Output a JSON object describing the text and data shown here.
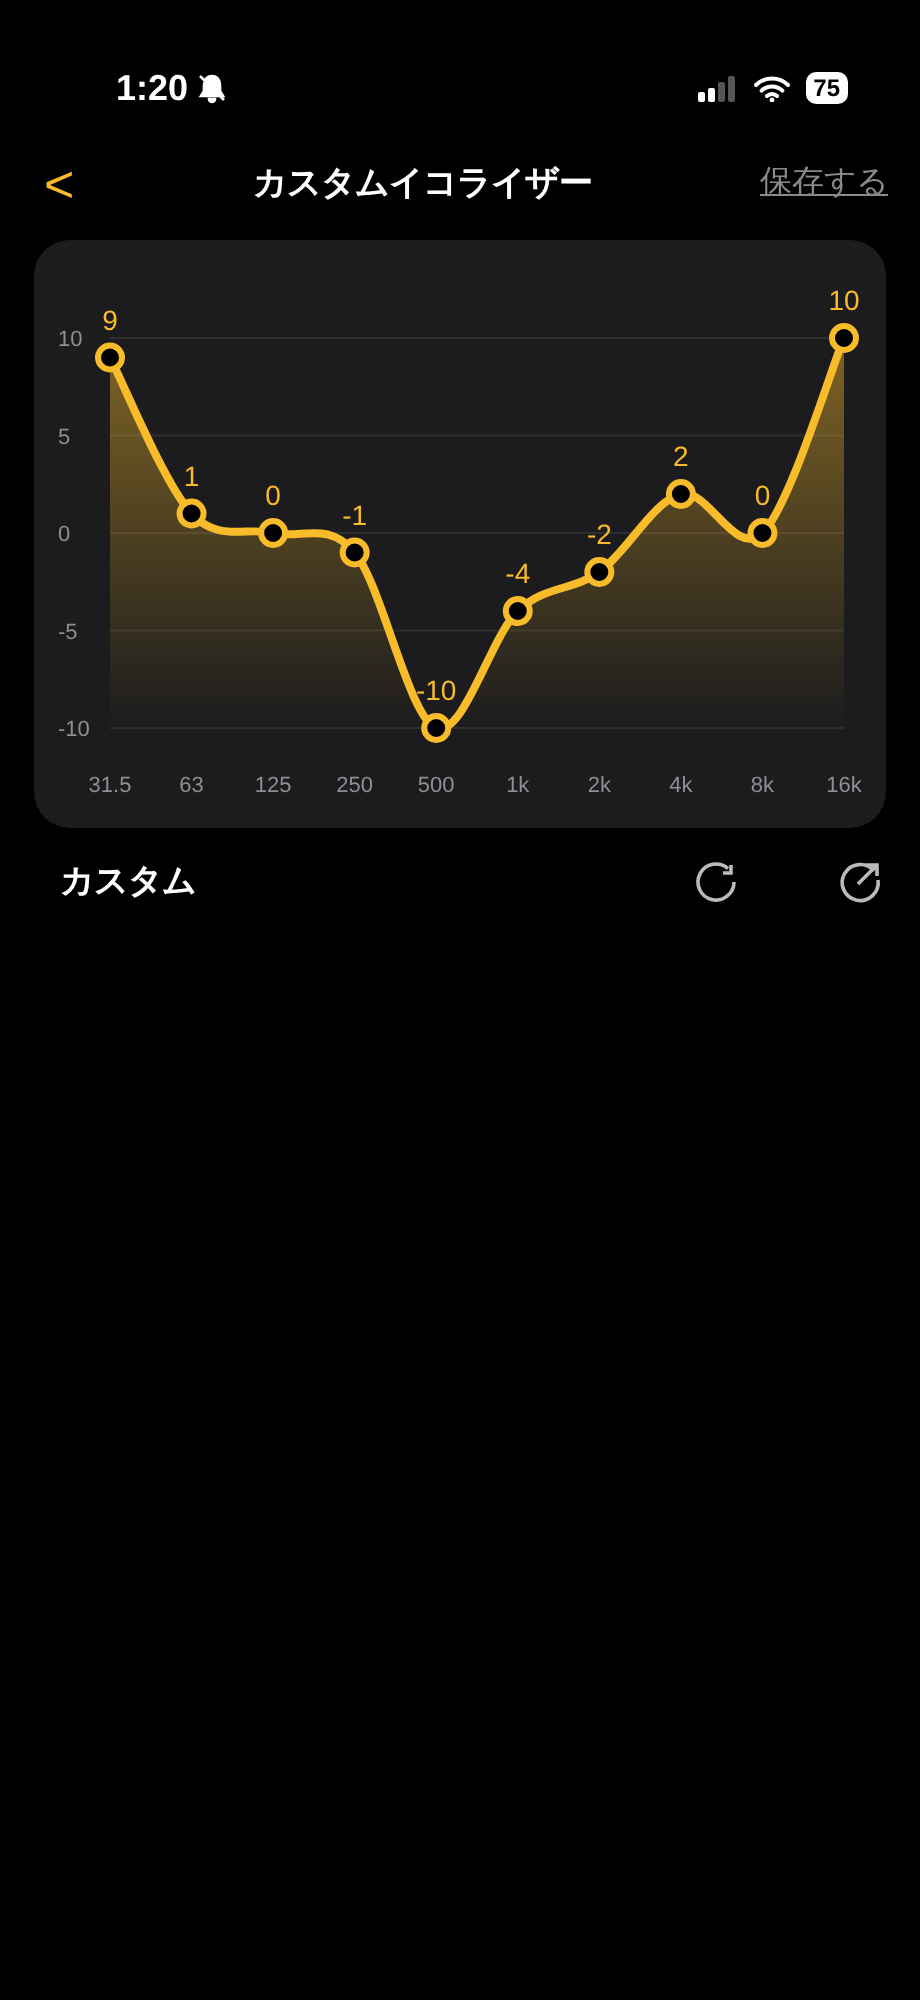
{
  "status_bar": {
    "time": "1:20",
    "battery": "75"
  },
  "nav": {
    "back": "<",
    "title": "カスタムイコライザー",
    "action": "保存する"
  },
  "equalizer": {
    "chart_data": {
      "type": "line",
      "grid": true,
      "categories": [
        "31.5",
        "63",
        "125",
        "250",
        "500",
        "1k",
        "2k",
        "4k",
        "8k",
        "16k"
      ],
      "series": [
        {
          "color": "#f8bb2a",
          "marker": "circle",
          "values": [
            9,
            1,
            0,
            -1,
            -10,
            -4,
            -2,
            2,
            0,
            10
          ]
        }
      ],
      "ylim": [
        -10,
        10
      ],
      "yticks": [
        10,
        5,
        0,
        -5,
        -10
      ],
      "data_labels": true
    }
  },
  "preset": {
    "name": "カスタム"
  }
}
